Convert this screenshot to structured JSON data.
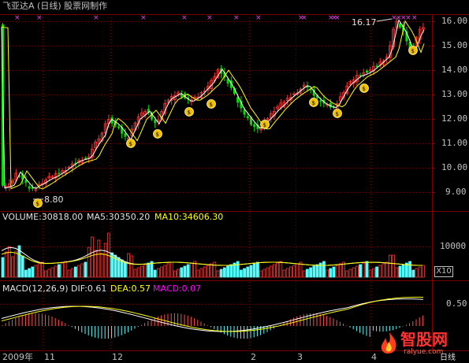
{
  "header": {
    "title": "飞亚达A (日线) 股票网制作",
    "colors": {
      "title": "#e0e0e0",
      "up": "#ff3232",
      "down": "#54fcfc",
      "grid": "#7a0000"
    }
  },
  "price_panel": {
    "y_ticks": [
      "16.00",
      "15.00",
      "14.00",
      "13.00",
      "12.00",
      "11.00",
      "10.00",
      "9.00"
    ],
    "high_label": "16.17",
    "low_label": "8.80",
    "money_bag_icon": "money-bag-icon",
    "mark_icon": "purple-x-mark"
  },
  "volume_panel": {
    "label": "VOLUME:30818.00",
    "ma5": "MA5:30350.20",
    "ma10": "MA10:34606.30",
    "y_tick": "10000",
    "unit_button": "X10"
  },
  "macd_panel": {
    "label": "MACD(12,26,9)",
    "dif": "DIF:0.61",
    "dea": "DEA:0.57",
    "macd": "MACD:0.07",
    "y_tick": "0.50"
  },
  "x_axis": {
    "labels": [
      "2009年",
      "11",
      "12",
      "2",
      "3",
      "4"
    ],
    "period_button": "日线"
  },
  "watermark": {
    "brand": "智股网",
    "url": "ralyue.com"
  }
}
